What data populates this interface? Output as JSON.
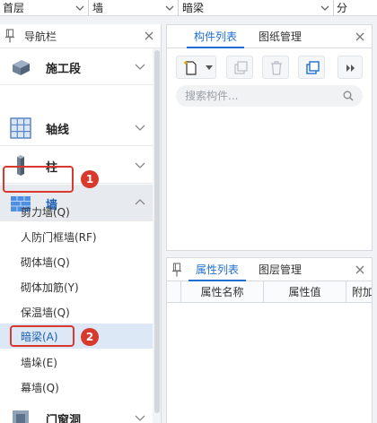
{
  "topbar": {
    "dropdowns": [
      {
        "value": "首层"
      },
      {
        "value": "墙"
      },
      {
        "value": "暗梁"
      },
      {
        "value": "分"
      }
    ]
  },
  "nav": {
    "title": "导航栏",
    "categories": [
      {
        "label": "施工段",
        "icon": "construction-segment-icon"
      },
      {
        "label": "轴线",
        "icon": "axis-grid-icon"
      },
      {
        "label": "柱",
        "icon": "column-icon"
      },
      {
        "label": "墙",
        "icon": "wall-icon"
      },
      {
        "label": "门窗洞",
        "icon": "door-window-icon"
      }
    ],
    "wall_items": [
      {
        "label": "剪力墙(Q)"
      },
      {
        "label": "人防门框墙(RF)"
      },
      {
        "label": "砌体墙(Q)"
      },
      {
        "label": "砌体加筋(Y)"
      },
      {
        "label": "保温墙(Q)"
      },
      {
        "label": "暗梁(A)"
      },
      {
        "label": "墙垛(E)"
      },
      {
        "label": "幕墙(Q)"
      }
    ],
    "selected_item": "暗梁(A)"
  },
  "annotations": {
    "badge_1": "1",
    "badge_2": "2",
    "color": "#d9392d"
  },
  "component_panel": {
    "tabs": [
      {
        "label": "构件列表"
      },
      {
        "label": "图纸管理"
      }
    ],
    "active_tab": "构件列表",
    "search_placeholder": "搜索构件..."
  },
  "property_panel": {
    "tabs": [
      {
        "label": "属性列表"
      },
      {
        "label": "图层管理"
      }
    ],
    "active_tab": "属性列表",
    "columns": [
      {
        "label": "属性名称"
      },
      {
        "label": "属性值"
      },
      {
        "label": "附加"
      }
    ]
  },
  "colors": {
    "accent": "#1f6fd1",
    "highlight": "#d9392d",
    "selected_bg": "#dce8f6"
  }
}
